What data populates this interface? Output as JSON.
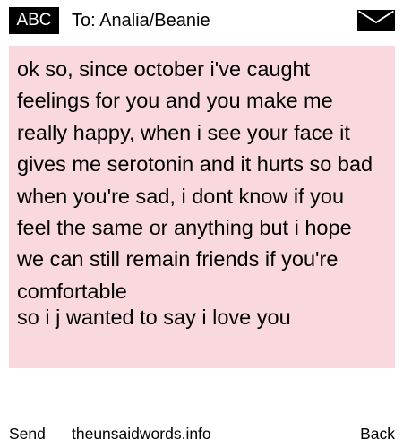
{
  "header": {
    "input_mode": "ABC",
    "recipient": "To: Analia/Beanie",
    "envelope_icon": "envelope-icon"
  },
  "message": {
    "body": "ok so, since october i've caught feelings for you and you make me really happy, when i see your face it gives me serotonin and it hurts so bad when you're sad, i dont know if you feel the same or anything but i hope we can still remain friends if you're comfortable",
    "last_line": "so i j wanted to say i love you",
    "background_color": "#f9d9dd"
  },
  "softkeys": {
    "left": "Send",
    "center": "theunsaidwords.info",
    "right": "Back"
  }
}
